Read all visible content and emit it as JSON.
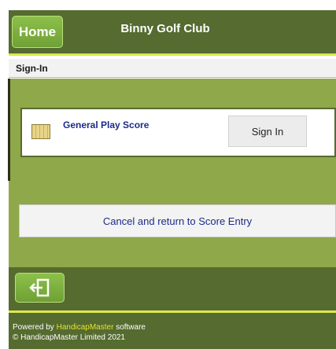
{
  "header": {
    "home_label": "Home",
    "site_title": "Binny Golf Club"
  },
  "breadcrumb": {
    "label": "Sign-In"
  },
  "score_entry": {
    "title": "General Play Score",
    "sign_in_label": "Sign In",
    "icon": "scorecard-icon"
  },
  "actions": {
    "cancel_label": "Cancel and return to Score Entry",
    "exit_icon": "exit-icon"
  },
  "footer": {
    "powered_prefix": "Powered by",
    "brand": "HandicapMaster",
    "powered_suffix": "software",
    "copyright": "© HandicapMaster Limited 2021"
  },
  "colors": {
    "header_green": "#556b2f",
    "content_green": "#8ea84a",
    "button_green": "#7cb342",
    "accent_yellow": "#dfe84c",
    "link_blue": "#1b2b8a"
  }
}
